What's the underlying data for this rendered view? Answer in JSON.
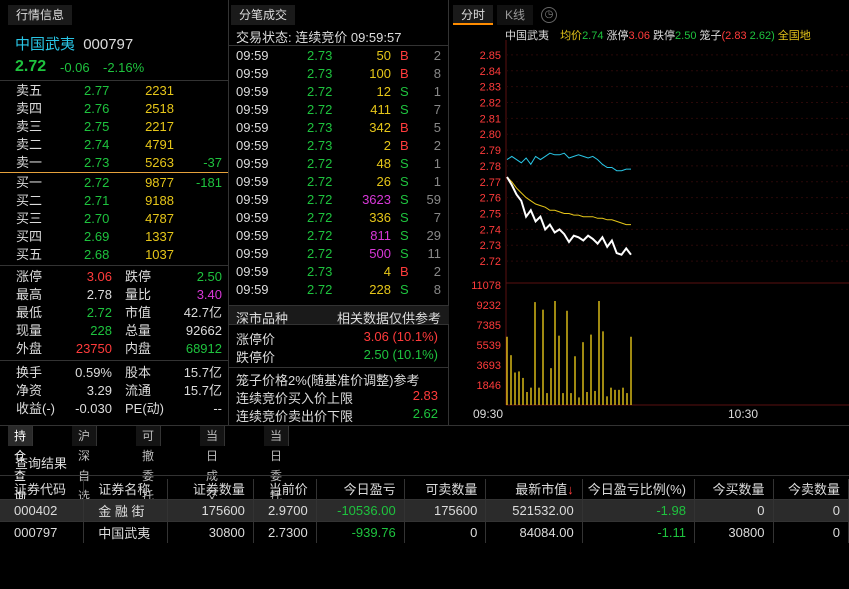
{
  "left": {
    "tab": "行情信息",
    "stock_name": "中国武夷",
    "stock_code": "000797",
    "price": "2.72",
    "change": "-0.06",
    "pct": "-2.16%",
    "asks": [
      {
        "l": "卖五",
        "p": "2.77",
        "v": "2231",
        "d": ""
      },
      {
        "l": "卖四",
        "p": "2.76",
        "v": "2518",
        "d": ""
      },
      {
        "l": "卖三",
        "p": "2.75",
        "v": "2217",
        "d": ""
      },
      {
        "l": "卖二",
        "p": "2.74",
        "v": "4791",
        "d": ""
      },
      {
        "l": "卖一",
        "p": "2.73",
        "v": "5263",
        "d": "-37"
      }
    ],
    "bids": [
      {
        "l": "买一",
        "p": "2.72",
        "v": "9877",
        "d": "-181"
      },
      {
        "l": "买二",
        "p": "2.71",
        "v": "9188",
        "d": ""
      },
      {
        "l": "买三",
        "p": "2.70",
        "v": "4787",
        "d": ""
      },
      {
        "l": "买四",
        "p": "2.69",
        "v": "1337",
        "d": ""
      },
      {
        "l": "买五",
        "p": "2.68",
        "v": "1037",
        "d": ""
      }
    ],
    "stats": [
      {
        "a": "涨停",
        "av": "3.06",
        "b": "跌停",
        "bv": "2.50"
      },
      {
        "a": "最高",
        "av": "2.78",
        "b": "量比",
        "bv": "3.40"
      },
      {
        "a": "最低",
        "av": "2.72",
        "b": "市值",
        "bv": "42.7亿"
      },
      {
        "a": "现量",
        "av": "228",
        "b": "总量",
        "bv": "92662"
      },
      {
        "a": "外盘",
        "av": "23750",
        "b": "内盘",
        "bv": "68912"
      }
    ],
    "stats2": [
      {
        "a": "换手",
        "av": "0.59%",
        "b": "股本",
        "bv": "15.7亿"
      },
      {
        "a": "净资",
        "av": "3.29",
        "b": "流通",
        "bv": "15.7亿"
      },
      {
        "a": "收益(-)",
        "av": "-0.030",
        "b": "PE(动)",
        "bv": "--"
      }
    ]
  },
  "mid": {
    "tab": "分笔成交",
    "status": "交易状态: 连续竞价 09:59:57",
    "trades": [
      [
        "09:59",
        "2.73",
        "50",
        "B",
        "2"
      ],
      [
        "09:59",
        "2.73",
        "100",
        "B",
        "8"
      ],
      [
        "09:59",
        "2.72",
        "12",
        "S",
        "1"
      ],
      [
        "09:59",
        "2.72",
        "411",
        "S",
        "7"
      ],
      [
        "09:59",
        "2.73",
        "342",
        "B",
        "5"
      ],
      [
        "09:59",
        "2.73",
        "2",
        "B",
        "2"
      ],
      [
        "09:59",
        "2.72",
        "48",
        "S",
        "1"
      ],
      [
        "09:59",
        "2.72",
        "26",
        "S",
        "1"
      ],
      [
        "09:59",
        "2.72",
        "3623",
        "S",
        "59"
      ],
      [
        "09:59",
        "2.72",
        "336",
        "S",
        "7"
      ],
      [
        "09:59",
        "2.72",
        "811",
        "S",
        "29"
      ],
      [
        "09:59",
        "2.72",
        "500",
        "S",
        "11"
      ],
      [
        "09:59",
        "2.73",
        "4",
        "B",
        "2"
      ],
      [
        "09:59",
        "2.72",
        "228",
        "S",
        "8"
      ]
    ],
    "ref_title": "深市品种",
    "ref_note": "相关数据仅供参考",
    "limit_up_label": "涨停价",
    "limit_up": "3.06 (10.1%)",
    "limit_down_label": "跌停价",
    "limit_down": "2.50 (10.1%)",
    "cage_title": "笼子价格2%(随基准价调整)参考",
    "buy_cap_label": "连续竞价买入价上限",
    "buy_cap": "2.83",
    "sell_floor_label": "连续竞价卖出价下限",
    "sell_floor": "2.62"
  },
  "chart": {
    "tab_time": "分时",
    "tab_k": "K线",
    "name": "中国武夷",
    "avg_label": "均价",
    "avg": "2.74",
    "up_label": "涨停",
    "up": "3.06",
    "down_label": "跌停",
    "down": "2.50",
    "cage_label": "笼子",
    "cage_hi": "(2.83",
    "cage_lo": "2.62)",
    "extra": "全国地",
    "price_ticks": [
      "2.85",
      "2.84",
      "2.83",
      "2.82",
      "2.81",
      "2.80",
      "2.79",
      "2.78",
      "2.77",
      "2.76",
      "2.75",
      "2.74",
      "2.73",
      "2.72"
    ],
    "vol_ticks": [
      "11078",
      "9232",
      "7385",
      "5539",
      "3693",
      "1846"
    ],
    "time_start": "09:30",
    "time_mid": "10:30",
    "chart_data": {
      "type": "line",
      "ylim": [
        2.715,
        2.855
      ],
      "price": [
        2.773,
        2.768,
        2.762,
        2.758,
        2.748,
        2.752,
        2.745,
        2.748,
        2.74,
        2.743,
        2.738,
        2.74,
        2.737,
        2.732,
        2.736,
        2.735,
        2.733,
        2.736,
        2.734,
        2.731,
        2.735,
        2.729,
        2.733,
        2.725,
        2.724,
        2.728,
        2.724
      ],
      "avg": [
        2.773,
        2.77,
        2.766,
        2.763,
        2.76,
        2.758,
        2.756,
        2.755,
        2.754,
        2.752,
        2.752,
        2.751,
        2.75,
        2.75,
        2.749,
        2.749,
        2.748,
        2.748,
        2.748,
        2.747,
        2.747,
        2.746,
        2.746,
        2.745,
        2.744,
        2.743,
        2.743
      ],
      "ref": [
        2.784,
        2.786,
        2.784,
        2.782,
        2.785,
        2.781,
        2.786,
        2.784,
        2.786,
        2.788,
        2.787,
        2.787,
        2.788,
        2.785,
        2.786,
        2.787,
        2.786,
        2.785,
        2.786,
        2.784,
        2.781,
        2.779,
        2.779,
        2.777,
        2.777,
        2.778,
        2.778
      ],
      "volume": [
        6300,
        4600,
        3000,
        3100,
        2500,
        1200,
        1600,
        9500,
        1600,
        8800,
        1100,
        3400,
        9600,
        6400,
        1100,
        8700,
        1100,
        4500,
        700,
        5800,
        1200,
        6500,
        1300,
        9600,
        6800,
        800,
        1600,
        1400,
        1400,
        1600,
        1100,
        6300
      ]
    }
  },
  "bottom": {
    "tabs": [
      "持仓查询",
      "沪深自选",
      "可撤委托",
      "当日成交",
      "当日委托"
    ],
    "result_title": "查询结果",
    "headers": [
      "证券代码",
      "证券名称",
      "证券数量",
      "当前价",
      "今日盈亏",
      "可卖数量",
      "最新市值",
      "今日盈亏比例(%)",
      "今买数量",
      "今卖数量"
    ],
    "rows": [
      [
        "000402",
        "金 融 街",
        "175600",
        "2.9700",
        "-10536.00",
        "175600",
        "521532.00",
        "-1.98",
        "0",
        "0"
      ],
      [
        "000797",
        "中国武夷",
        "30800",
        "2.7300",
        "-939.76",
        "0",
        "84084.00",
        "-1.11",
        "30800",
        "0"
      ]
    ]
  }
}
